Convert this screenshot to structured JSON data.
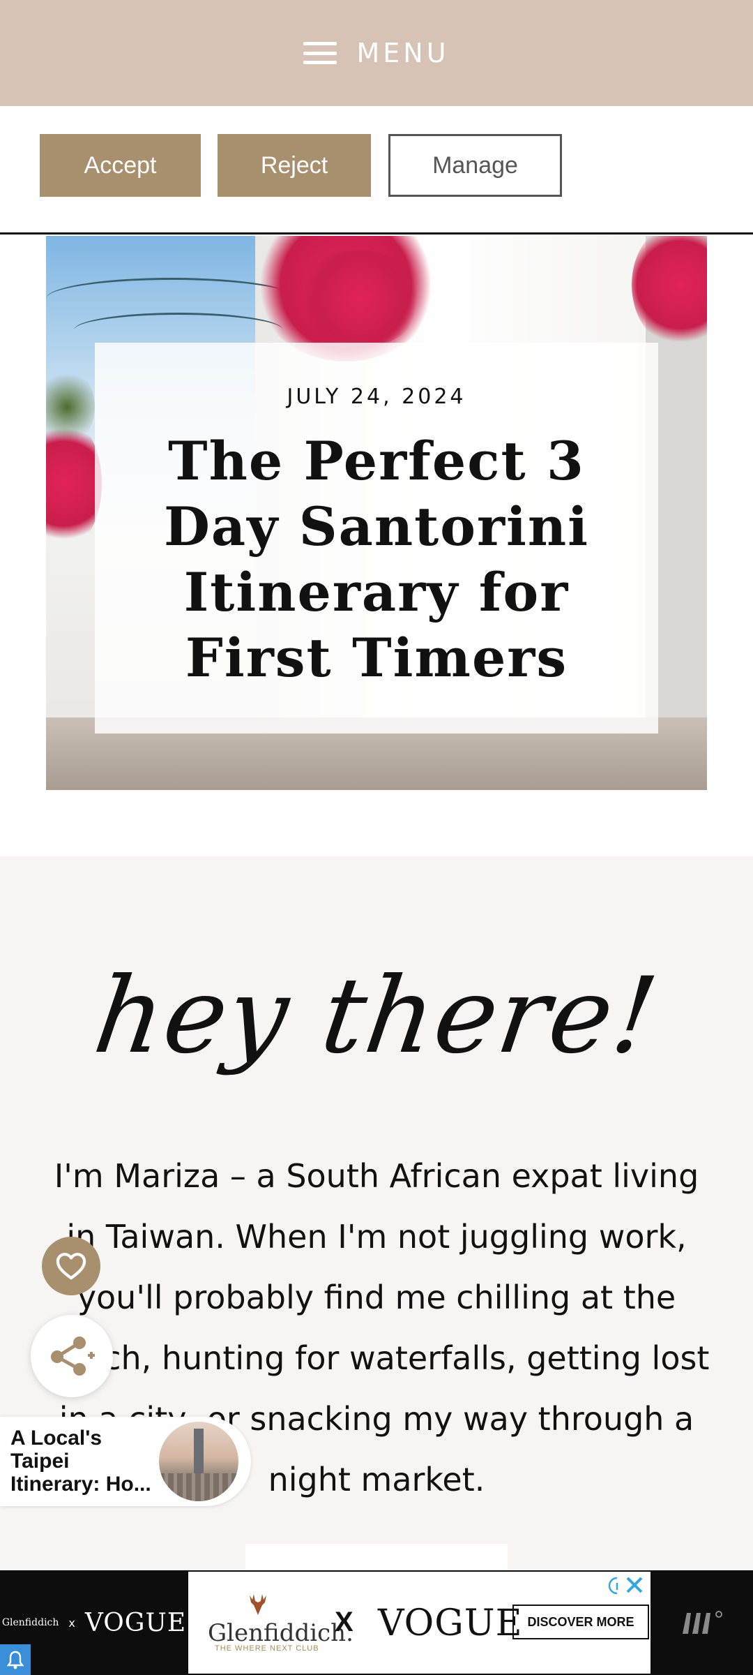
{
  "header": {
    "menu_label": "MENU"
  },
  "cookie_banner": {
    "accept_label": "Accept",
    "reject_label": "Reject",
    "manage_label": "Manage"
  },
  "post": {
    "date": "JULY 24, 2024",
    "title": "The Perfect 3 Day Santorini Itinerary for First Timers"
  },
  "about": {
    "heading": "hey there!",
    "text": "I'm Mariza – a South African expat living in Taiwan. When I'm not juggling work, you'll probably find me chilling at the beach, hunting for waterfalls, getting lost in a city, or snacking my way through a night market."
  },
  "floating": {
    "heart_icon": "heart-icon",
    "share_icon": "share-icon"
  },
  "related_post": {
    "title": "A Local's Taipei Itinerary: Ho..."
  },
  "ad": {
    "left_brand": "Glenfiddich",
    "left_x": "x",
    "left_vogue": "VOGUE",
    "brand": "Glenfiddich.",
    "brand_sub": "THE WHERE NEXT CLUB",
    "x": "X",
    "vogue": "VOGUE",
    "cta": "DISCOVER MORE"
  },
  "colors": {
    "header_bg": "#d6c3b5",
    "accent": "#a88f6e",
    "about_bg": "#f7f5f3",
    "ad_bg": "#0d0d0d"
  }
}
